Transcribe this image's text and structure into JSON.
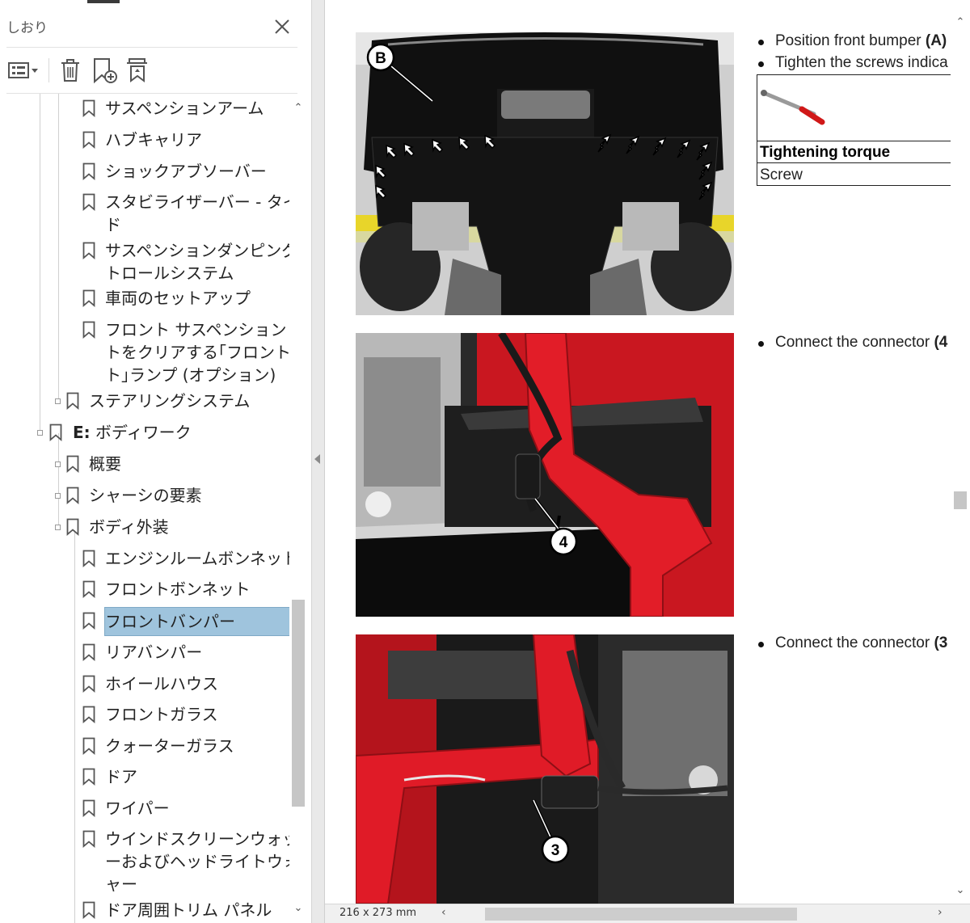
{
  "pane": {
    "title": "しおり",
    "toolbar": [
      "options-menu-icon",
      "delete-icon",
      "new-bookmark-icon",
      "bookmark-search-icon"
    ],
    "tree": [
      {
        "label": "サスペンションアーム"
      },
      {
        "label": "ハブキャリア"
      },
      {
        "label": "ショックアブソーバー"
      },
      {
        "label_lines": [
          "スタビライザーバー - タイロッ",
          "ド"
        ]
      },
      {
        "label_lines": [
          "サスペンションダンピングコン",
          "トロールシステム"
        ]
      },
      {
        "label": "車両のセットアップ"
      },
      {
        "label_lines": [
          "フロント サスペンション リフ",
          "トをクリアする｢フロント リフ",
          "ト｣ランプ (オプション)"
        ]
      },
      {
        "label": "ステアリングシステム"
      },
      {
        "label_prefix": "E:",
        "label": " ボディワーク"
      },
      {
        "label": "概要"
      },
      {
        "label": "シャーシの要素"
      },
      {
        "label": "ボディ外装"
      },
      {
        "label": "エンジンルームボンネット"
      },
      {
        "label": "フロントボンネット"
      },
      {
        "label": "フロントバンパー"
      },
      {
        "label": "リアバンパー"
      },
      {
        "label": "ホイールハウス"
      },
      {
        "label": "フロントガラス"
      },
      {
        "label": "クォーターガラス"
      },
      {
        "label": "ドア"
      },
      {
        "label": "ワイパー"
      },
      {
        "label_lines": [
          "ウインドスクリーンウォッシャ",
          "ーおよびヘッドライトウォッシ",
          "ャー"
        ]
      },
      {
        "label": "ドア周囲トリム パネル"
      }
    ]
  },
  "document": {
    "bullet1": "Position front bumper ",
    "bullet1_ref": "(A)",
    "bullet2": "Tighten the screws indica",
    "torque_header": "Tightening torque",
    "torque_cell": "Screw",
    "bullet3": "Connect the connector ",
    "bullet3_ref": "(4",
    "bullet4": "Connect the connector ",
    "bullet4_ref": "(3",
    "callout_b": "B",
    "callout_4": "4",
    "callout_3": "3"
  },
  "statusbar": {
    "page_size": "216 x 273 mm"
  }
}
